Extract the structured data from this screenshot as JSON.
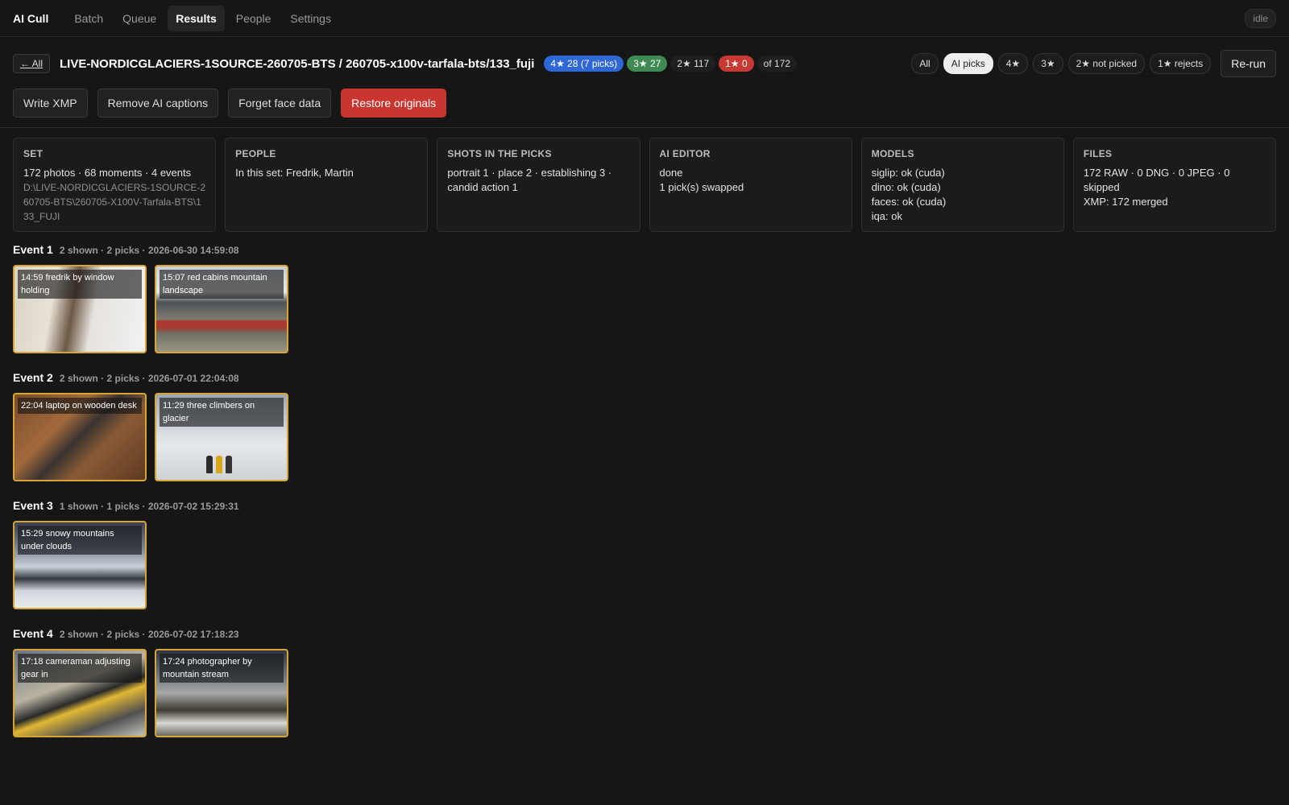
{
  "app": {
    "title": "AI Cull",
    "status": "idle"
  },
  "nav": [
    {
      "label": "Batch",
      "active": false
    },
    {
      "label": "Queue",
      "active": false
    },
    {
      "label": "Results",
      "active": true
    },
    {
      "label": "People",
      "active": false
    },
    {
      "label": "Settings",
      "active": false
    }
  ],
  "header": {
    "back_label": "← All",
    "path": "LIVE-NORDICGLACIERS-1SOURCE-260705-BTS / 260705-x100v-tarfala-bts/133_fuji",
    "badges": {
      "four_star": "4★ 28 (7 picks)",
      "three_star": "3★ 27",
      "two_star": "2★ 117",
      "one_star": "1★ 0",
      "total": "of 172"
    },
    "filters": [
      "All",
      "AI picks",
      "4★",
      "3★",
      "2★ not picked",
      "1★ rejects"
    ],
    "active_filter": "AI picks",
    "rerun_label": "Re-run"
  },
  "actions": {
    "write_xmp": "Write XMP",
    "remove_captions": "Remove AI captions",
    "forget_faces": "Forget face data",
    "restore": "Restore originals"
  },
  "cards": {
    "set": {
      "title": "SET",
      "line1": "172 photos · 68 moments · 4 events",
      "path": "D:\\LIVE-NORDICGLACIERS-1SOURCE-260705-BTS\\260705-X100V-Tarfala-BTS\\133_FUJI"
    },
    "people": {
      "title": "PEOPLE",
      "line1": "In this set: Fredrik, Martin"
    },
    "shots": {
      "title": "SHOTS IN THE PICKS",
      "line1": "portrait 1 · place 2 · establishing 3 · candid action 1"
    },
    "editor": {
      "title": "AI EDITOR",
      "line1": "done",
      "line2": "1 pick(s) swapped"
    },
    "models": {
      "title": "MODELS",
      "line1": "siglip: ok (cuda)",
      "line2": "dino: ok (cuda)",
      "line3": "faces: ok (cuda)",
      "line4": "iqa: ok"
    },
    "files": {
      "title": "FILES",
      "line1": "172 RAW · 0 DNG · 0 JPEG · 0 skipped",
      "line2": "XMP: 172 merged"
    }
  },
  "events": [
    {
      "title": "Event 1",
      "meta": "2 shown · 2 picks · 2026-06-30 14:59:08",
      "photos": [
        {
          "caption": "14:59 fredrik by window holding"
        },
        {
          "caption": "15:07 red cabins mountain landscape"
        }
      ]
    },
    {
      "title": "Event 2",
      "meta": "2 shown · 2 picks · 2026-07-01 22:04:08",
      "photos": [
        {
          "caption": "22:04 laptop on wooden desk"
        },
        {
          "caption": "11:29 three climbers on glacier"
        }
      ]
    },
    {
      "title": "Event 3",
      "meta": "1 shown · 1 picks · 2026-07-02 15:29:31",
      "photos": [
        {
          "caption": "15:29 snowy mountains under clouds"
        }
      ]
    },
    {
      "title": "Event 4",
      "meta": "2 shown · 2 picks · 2026-07-02 17:18:23",
      "photos": [
        {
          "caption": "17:18 cameraman adjusting gear in"
        },
        {
          "caption": "17:24 photographer by mountain stream"
        }
      ]
    }
  ],
  "colors": {
    "pick_border": "#d6a534",
    "danger": "#c9362f",
    "blue": "#2f67d6",
    "green": "#3e8a52"
  }
}
